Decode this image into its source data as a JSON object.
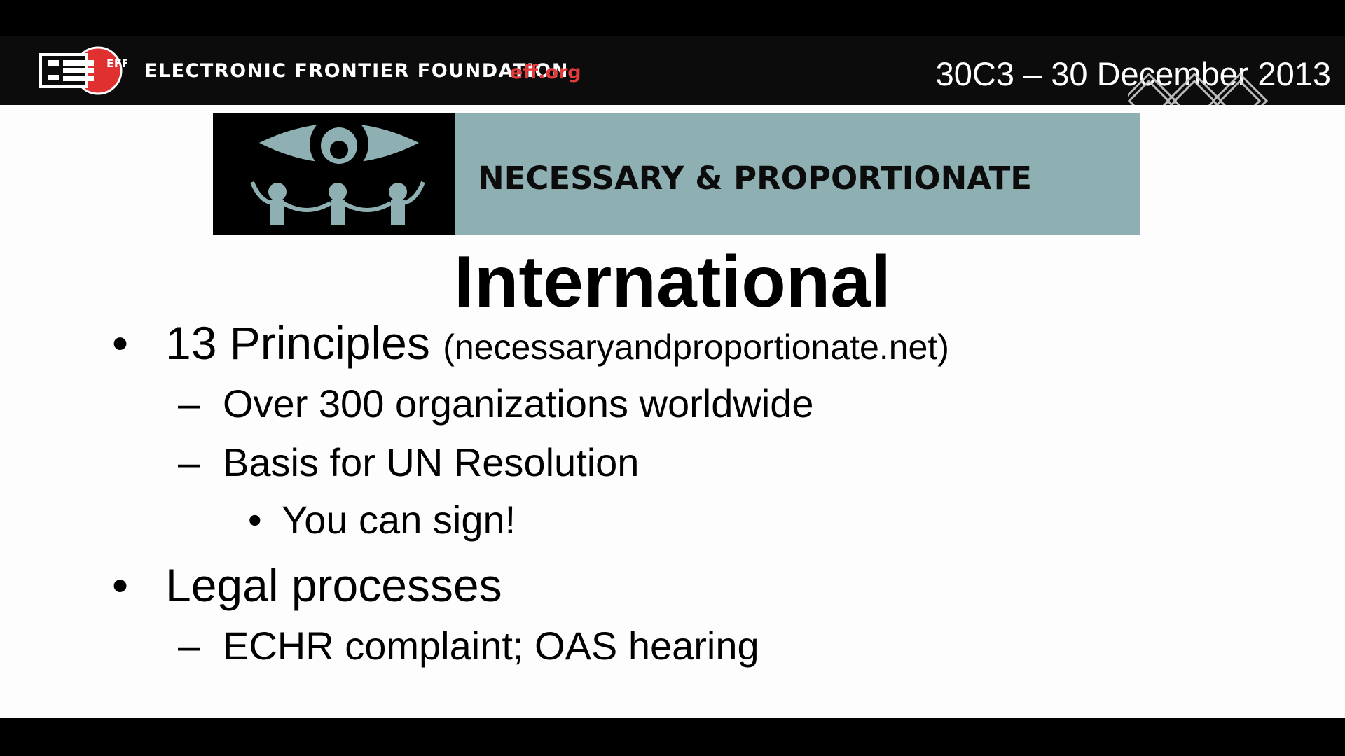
{
  "header": {
    "org_name": "ELECTRONIC FRONTIER FOUNDATION",
    "org_url": "eff.org",
    "event": "30C3 – 30 December 2013",
    "logo_letters": "EFF"
  },
  "banner": {
    "title": "NECESSARY & PROPORTIONATE",
    "icon": "eye-with-people-icon",
    "background_color": "#8eb0b3"
  },
  "slide": {
    "title": "International",
    "bullets": [
      {
        "level": 1,
        "marker": "•",
        "text": "13 Principles",
        "suffix": "(necessaryandproportionate.net)"
      },
      {
        "level": 2,
        "marker": "–",
        "text": "Over 300 organizations worldwide"
      },
      {
        "level": 2,
        "marker": "–",
        "text": "Basis for UN Resolution"
      },
      {
        "level": 3,
        "marker": "•",
        "text": "You can sign!"
      },
      {
        "level": 1,
        "marker": "•",
        "text": "Legal processes"
      },
      {
        "level": 2,
        "marker": "–",
        "text": "ECHR complaint; OAS hearing"
      }
    ]
  },
  "colors": {
    "accent_red": "#e23b3b",
    "banner": "#8eb0b3"
  }
}
